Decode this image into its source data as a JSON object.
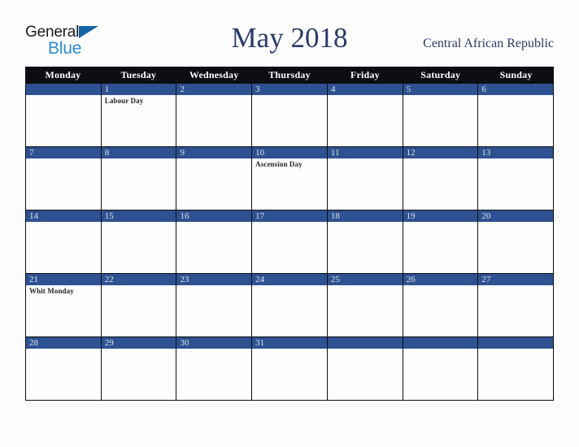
{
  "brand": {
    "name_part1": "General",
    "name_part2": "Blue",
    "triangle_color": "#1464a5",
    "blue_color": "#2e8bd0"
  },
  "header": {
    "title": "May 2018",
    "region": "Central African Republic",
    "title_color": "#2b3a67"
  },
  "colors": {
    "weekday_header_bg": "#0d0d14",
    "day_bar_bg": "#2e5291",
    "day_number_text": "#dfe3ec",
    "cell_bg": "#fdfdfd",
    "grid_line": "#0d0d14",
    "page_bg": "#fcfcfd"
  },
  "weekdays": [
    "Monday",
    "Tuesday",
    "Wednesday",
    "Thursday",
    "Friday",
    "Saturday",
    "Sunday"
  ],
  "weeks": [
    [
      {
        "day": "",
        "event": ""
      },
      {
        "day": "1",
        "event": "Labour Day"
      },
      {
        "day": "2",
        "event": ""
      },
      {
        "day": "3",
        "event": ""
      },
      {
        "day": "4",
        "event": ""
      },
      {
        "day": "5",
        "event": ""
      },
      {
        "day": "6",
        "event": ""
      }
    ],
    [
      {
        "day": "7",
        "event": ""
      },
      {
        "day": "8",
        "event": ""
      },
      {
        "day": "9",
        "event": ""
      },
      {
        "day": "10",
        "event": "Ascension Day"
      },
      {
        "day": "11",
        "event": ""
      },
      {
        "day": "12",
        "event": ""
      },
      {
        "day": "13",
        "event": ""
      }
    ],
    [
      {
        "day": "14",
        "event": ""
      },
      {
        "day": "15",
        "event": ""
      },
      {
        "day": "16",
        "event": ""
      },
      {
        "day": "17",
        "event": ""
      },
      {
        "day": "18",
        "event": ""
      },
      {
        "day": "19",
        "event": ""
      },
      {
        "day": "20",
        "event": ""
      }
    ],
    [
      {
        "day": "21",
        "event": "Whit Monday"
      },
      {
        "day": "22",
        "event": ""
      },
      {
        "day": "23",
        "event": ""
      },
      {
        "day": "24",
        "event": ""
      },
      {
        "day": "25",
        "event": ""
      },
      {
        "day": "26",
        "event": ""
      },
      {
        "day": "27",
        "event": ""
      }
    ],
    [
      {
        "day": "28",
        "event": ""
      },
      {
        "day": "29",
        "event": ""
      },
      {
        "day": "30",
        "event": ""
      },
      {
        "day": "31",
        "event": ""
      },
      {
        "day": "",
        "event": ""
      },
      {
        "day": "",
        "event": ""
      },
      {
        "day": "",
        "event": ""
      }
    ]
  ]
}
